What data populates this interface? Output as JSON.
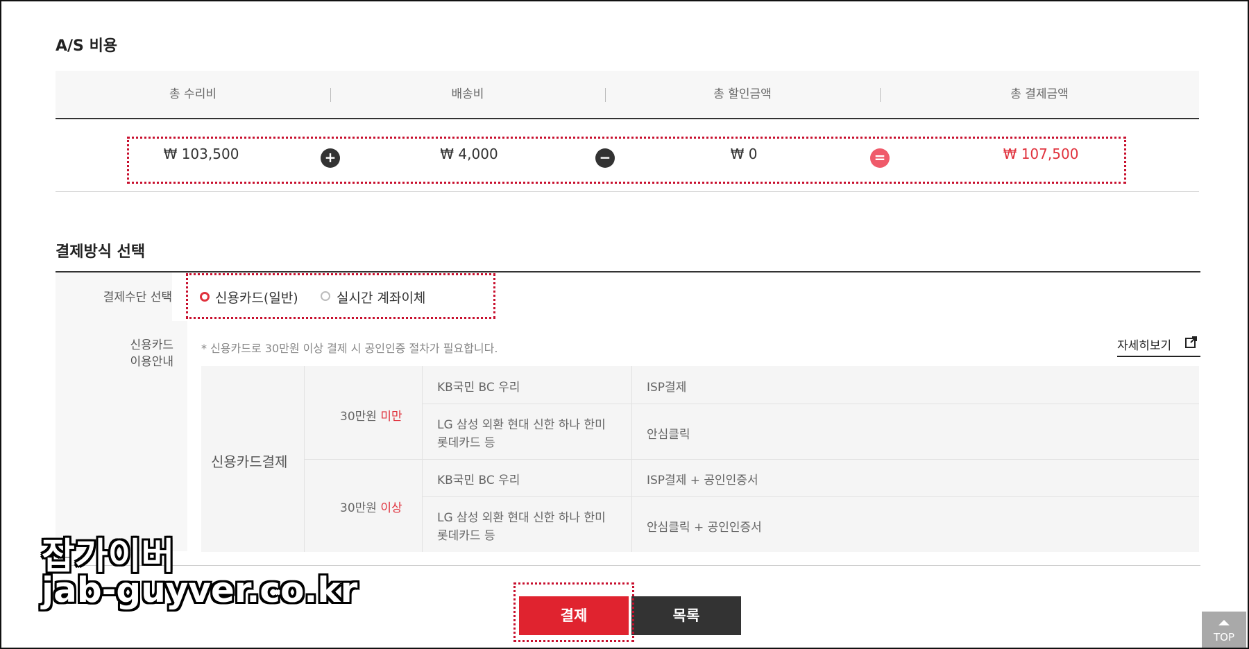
{
  "as_section": {
    "title": "A/S 비용",
    "headers": [
      "총 수리비",
      "배송비",
      "총 할인금액",
      "총 결제금액"
    ],
    "amounts": [
      "₩ 103,500",
      "₩ 4,000",
      "₩ 0",
      "₩ 107,500"
    ],
    "operators": [
      "+",
      "−",
      "="
    ]
  },
  "payment_section": {
    "title": "결제방식 선택",
    "method_label": "결제수단 선택",
    "options": [
      {
        "label": "신용카드(일반)",
        "selected": true
      },
      {
        "label": "실시간 계좌이체",
        "selected": false
      }
    ],
    "guide_label_1": "신용카드",
    "guide_label_2": "이용안내",
    "notice": "* 신용카드로 30만원 이상 결제 시 공인인증 절차가 필요합니다.",
    "detail_link": "자세히보기",
    "table": {
      "category": "신용카드결제",
      "groups": [
        {
          "amount_prefix": "30만원 ",
          "amount_emph": "미만",
          "rows": [
            {
              "cards_1": "KB국민 BC 우리",
              "cards_2": "",
              "method": "ISP결제"
            },
            {
              "cards_1": "LG 삼성 외환 현대 신한 하나 한미",
              "cards_2": "롯데카드 등",
              "method": "안심클릭"
            }
          ]
        },
        {
          "amount_prefix": "30만원 ",
          "amount_emph": "이상",
          "rows": [
            {
              "cards_1": "KB국민 BC 우리",
              "cards_2": "",
              "method": "ISP결제 + 공인인증서"
            },
            {
              "cards_1": "LG 삼성 외환 현대 신한 하나 한미",
              "cards_2": "롯데카드 등",
              "method": "안심클릭 + 공인인증서"
            }
          ]
        }
      ]
    }
  },
  "buttons": {
    "pay": "결제",
    "list": "목록",
    "top": "TOP"
  },
  "watermark": {
    "line1": "잡가이버",
    "line2": "jab-guyver.co.kr"
  },
  "colors": {
    "accent": "#e0232f",
    "highlight_dots": "#c8102e",
    "dark": "#333333"
  }
}
